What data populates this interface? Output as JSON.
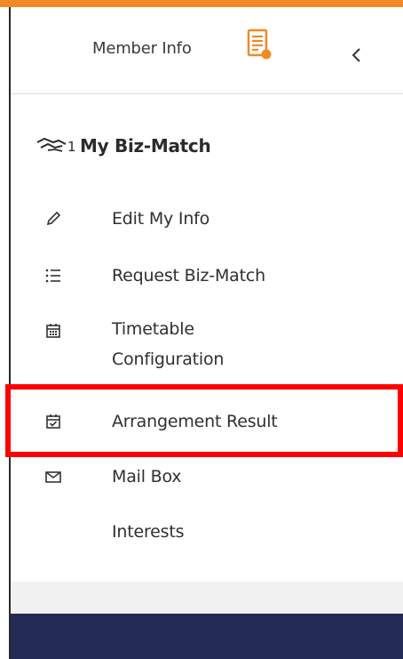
{
  "header": {
    "title": "Member Info",
    "title_icon": "member-doc-icon",
    "collapse_icon": "chevron-left-icon"
  },
  "section": {
    "title": "My Biz-Match",
    "icon": "handshake-icon",
    "icon_badge": "1"
  },
  "menu": {
    "items": [
      {
        "label": "Edit My Info",
        "icon": "pencil-icon"
      },
      {
        "label": "Request Biz-Match",
        "icon": "list-icon"
      },
      {
        "label_line1": "Timetable",
        "label_line2": "Configuration",
        "icon": "calendar-icon"
      },
      {
        "label": "Arrangement Result",
        "icon": "calendar-check-icon",
        "highlighted": true
      },
      {
        "label": "Mail Box",
        "icon": "envelope-icon"
      },
      {
        "label": "Interests",
        "icon": ""
      }
    ]
  },
  "colors": {
    "accent": "#f08a24",
    "highlight": "#ff0000",
    "bottom_bar": "#232a54",
    "text": "#2f2f2f"
  }
}
